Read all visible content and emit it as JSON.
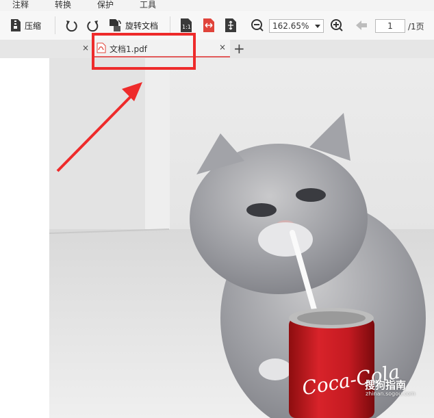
{
  "menubar": {
    "items": [
      "注释",
      "转换",
      "保护",
      "工具"
    ]
  },
  "toolbar": {
    "compress_label": "压缩",
    "rotate_doc_label": "旋转文档",
    "zoom_value": "162.65%",
    "page_current": "1",
    "page_total": "/1页"
  },
  "tabs": {
    "active_label": "文档1.pdf"
  },
  "content": {
    "can_text": "Coca-Cola"
  },
  "watermark": {
    "brand": "搜狗指南",
    "url": "zhinan.sogou.com"
  },
  "colors": {
    "annotation_red": "#ee2b2b",
    "tab_underline": "#e25b5b",
    "pdf_icon_red": "#e0443b"
  }
}
